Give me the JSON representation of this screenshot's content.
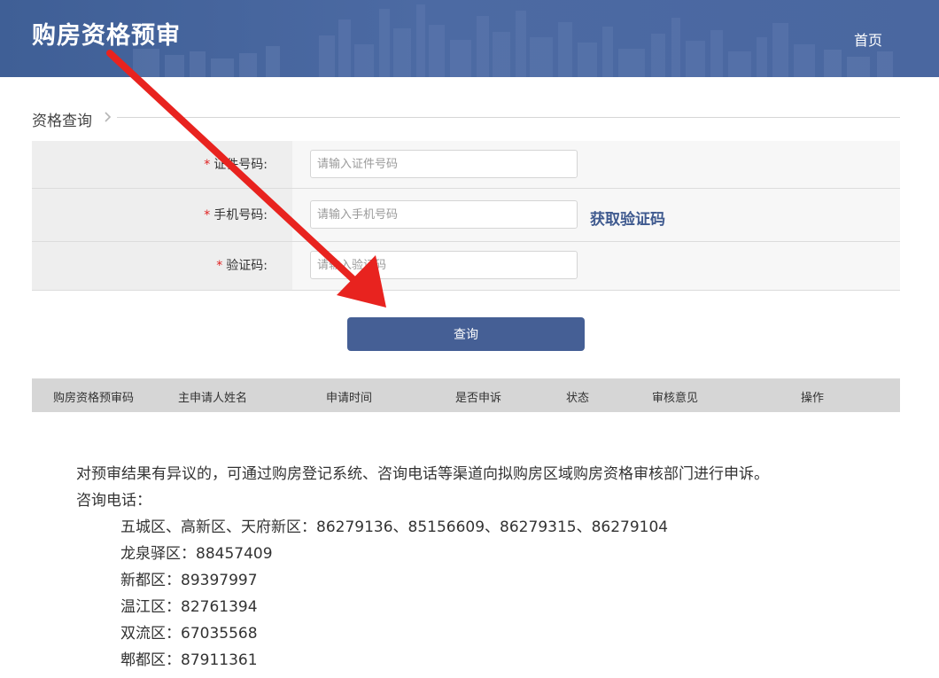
{
  "header": {
    "title": "购房资格预审",
    "home_label": "首页"
  },
  "section": {
    "title": "资格查询"
  },
  "form": {
    "rows": [
      {
        "label": "证件号码:",
        "placeholder": "请输入证件号码"
      },
      {
        "label": "手机号码:",
        "placeholder": "请输入手机号码",
        "action_label": "获取验证码"
      },
      {
        "label": "验证码:",
        "placeholder": "请输入验证码"
      }
    ],
    "required_mark": "*",
    "submit_label": "查询"
  },
  "results_table": {
    "columns": [
      "购房资格预审码",
      "主申请人姓名",
      "申请时间",
      "是否申诉",
      "状态",
      "审核意见",
      "操作"
    ],
    "rows": []
  },
  "notice": {
    "appeal_text": "对预审结果有异议的，可通过购房登记系统、咨询电话等渠道向拟购房区域购房资格审核部门进行申诉。",
    "hotline_heading": "咨询电话：",
    "hotlines": [
      {
        "area": "五城区、高新区、天府新区：",
        "numbers": "86279136、85156609、86279315、86279104"
      },
      {
        "area": "龙泉驿区：",
        "numbers": "88457409"
      },
      {
        "area": "新都区：",
        "numbers": "89397997"
      },
      {
        "area": "温江区：",
        "numbers": "82761394"
      },
      {
        "area": "双流区：",
        "numbers": "67035568"
      },
      {
        "area": "郫都区：",
        "numbers": "87911361"
      }
    ]
  },
  "colors": {
    "header_bg": "#4a67a0",
    "button_bg": "#455f95",
    "link_color": "#3f5a8f",
    "required_color": "#e02020",
    "annotation_arrow": "#e8231f"
  },
  "icons": {
    "section_marker": "chevron-right-icon",
    "annotation": "red-arrow-annotation"
  }
}
